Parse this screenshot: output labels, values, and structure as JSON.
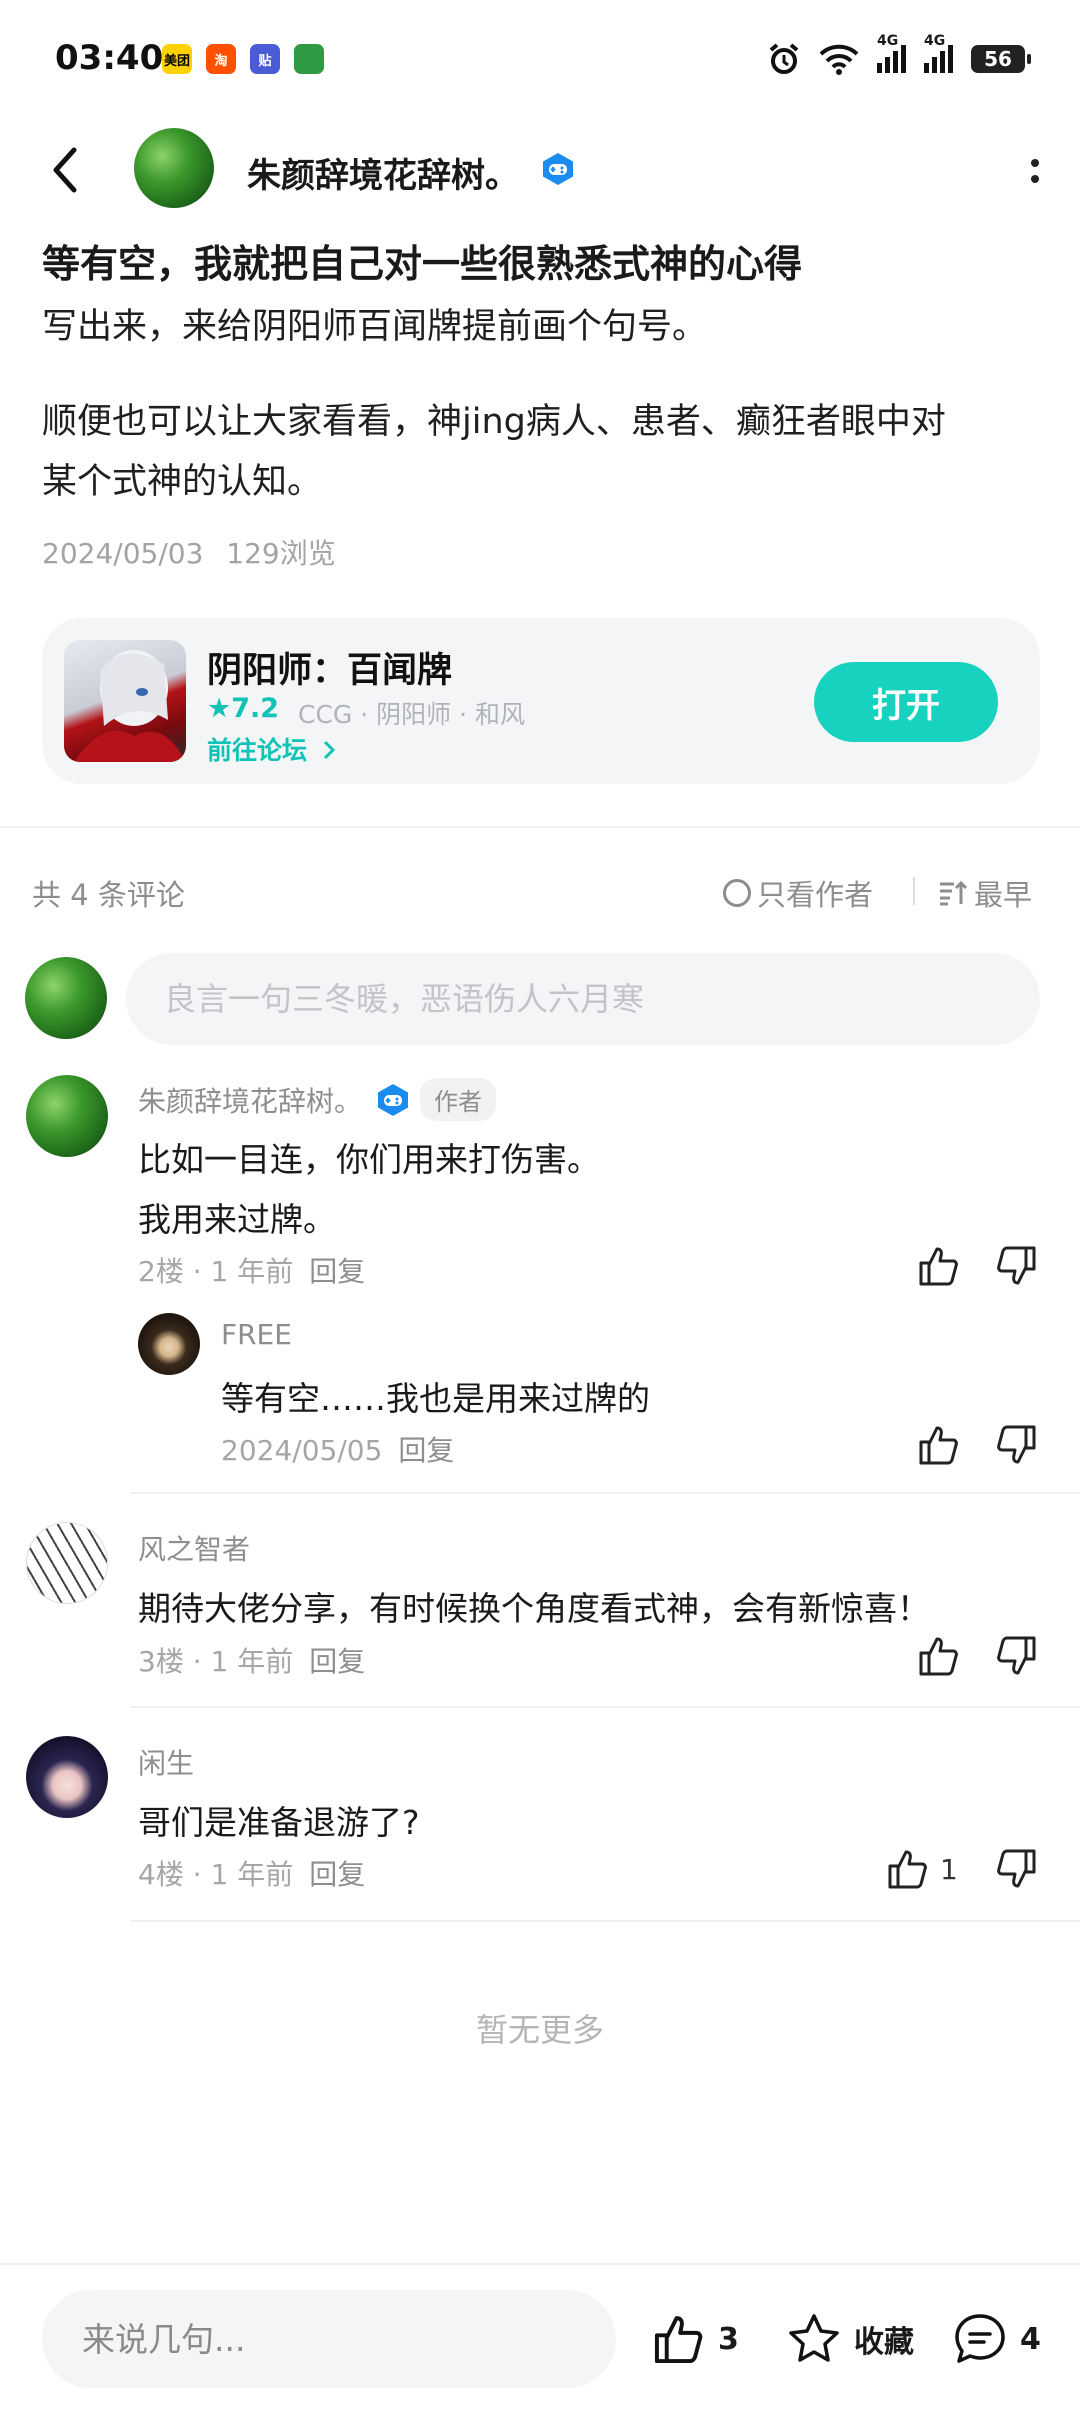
{
  "status_bar": {
    "time": "03:40",
    "battery": "56",
    "app_icons": [
      {
        "name": "meituan-icon",
        "label": "美团",
        "color": "#ffd100"
      },
      {
        "name": "taobao-icon",
        "label": "淘",
        "color": "#ff5000"
      },
      {
        "name": "tieba-icon",
        "label": "贴",
        "color": "#4a5bd6"
      },
      {
        "name": "green-app-icon",
        "label": "",
        "color": "#2e9b43"
      }
    ],
    "network": [
      "4G",
      "4G"
    ]
  },
  "header": {
    "author_name": "朱颜辞境花辞树。"
  },
  "post": {
    "title": "等有空，我就把自己对一些很熟悉式神的心得",
    "line2": "写出来，来给阴阳师百闻牌提前画个句号。",
    "line3": "顺便也可以让大家看看，神jing病人、患者、癫狂者眼中对",
    "line4": "某个式神的认知。",
    "date": "2024/05/03",
    "views": "129浏览"
  },
  "game_card": {
    "name": "阴阳师：百闻牌",
    "rating": "7.2",
    "tags": "CCG · 阴阳师 · 和风",
    "forum_link": "前往论坛",
    "open_label": "打开"
  },
  "comments_header": {
    "count": "共 4 条评论",
    "only_author": "只看作者",
    "sort": "最早"
  },
  "comment_input": {
    "placeholder": "良言一句三冬暖，恶语伤人六月寒"
  },
  "comments": [
    {
      "name": "朱颜辞境花辞树。",
      "author_tag": "作者",
      "lines": [
        "比如一目连，你们用来打伤害。",
        "我用来过牌。"
      ],
      "floor": "2楼 · 1 年前",
      "reply": "回复",
      "replies": [
        {
          "name": "FREE",
          "text": "等有空……我也是用来过牌的",
          "date": "2024/05/05",
          "reply": "回复"
        }
      ]
    },
    {
      "name": "风之智者",
      "text": "期待大佬分享，有时候换个角度看式神，会有新惊喜！",
      "floor": "3楼 · 1 年前",
      "reply": "回复"
    },
    {
      "name": "闲生",
      "text": "哥们是准备退游了?",
      "floor": "4楼 · 1 年前",
      "reply": "回复",
      "likes": "1"
    }
  ],
  "no_more": "暂无更多",
  "bottom_bar": {
    "input_placeholder": "来说几句...",
    "likes": "3",
    "favorite": "收藏",
    "comments": "4"
  },
  "colors": {
    "accent": "#16d2bf",
    "accent_text": "#11c2b6",
    "badge_blue": "#1a8cf0"
  }
}
